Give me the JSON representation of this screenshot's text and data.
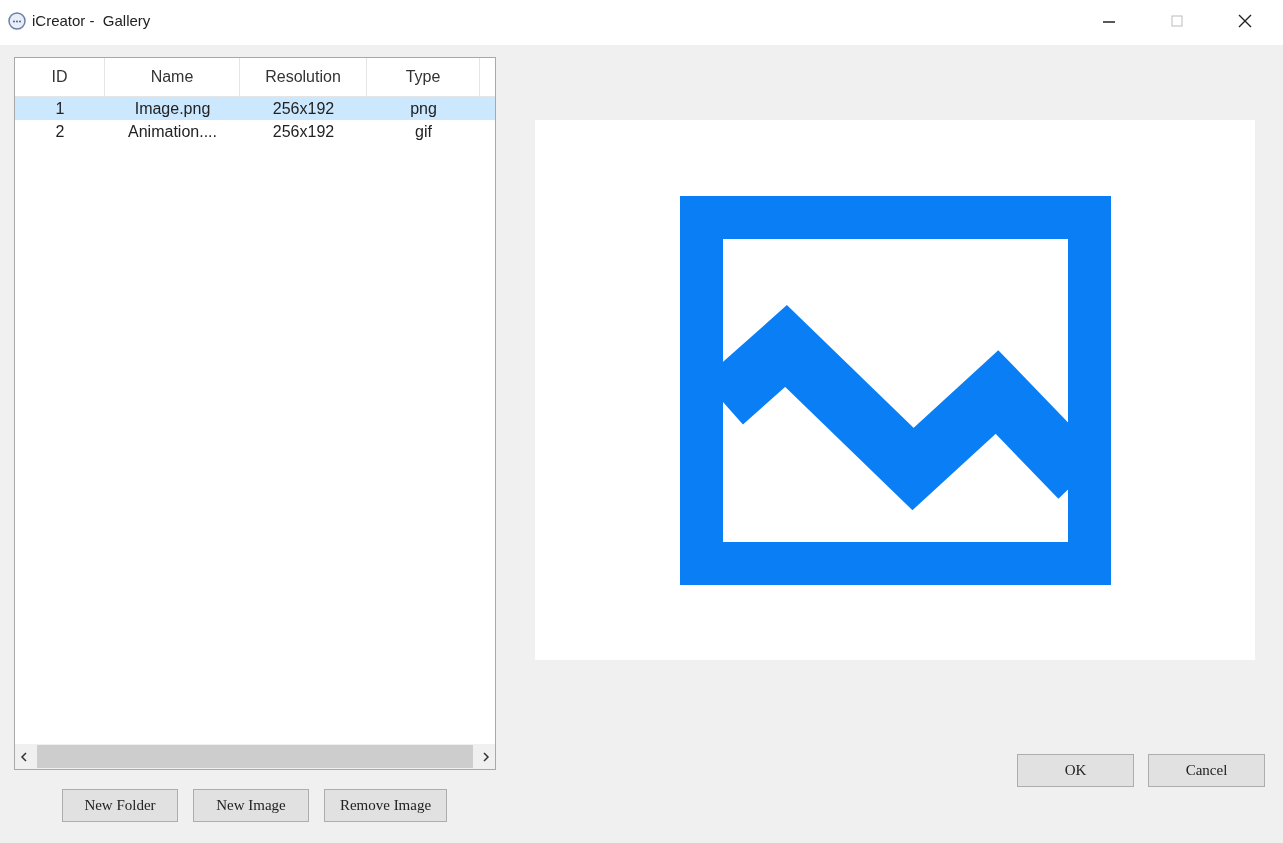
{
  "window": {
    "title": "iCreator -  Gallery"
  },
  "table": {
    "columns": [
      "ID",
      "Name",
      "Resolution",
      "Type"
    ],
    "rows": [
      {
        "cells": [
          "1",
          "Image.png",
          "256x192",
          "png"
        ],
        "selected": true
      },
      {
        "cells": [
          "2",
          "Animation....",
          "256x192",
          "gif"
        ],
        "selected": false
      }
    ]
  },
  "list_buttons": [
    "New Folder",
    "New Image",
    "Remove Image"
  ],
  "dialog_buttons": [
    "OK",
    "Cancel"
  ]
}
